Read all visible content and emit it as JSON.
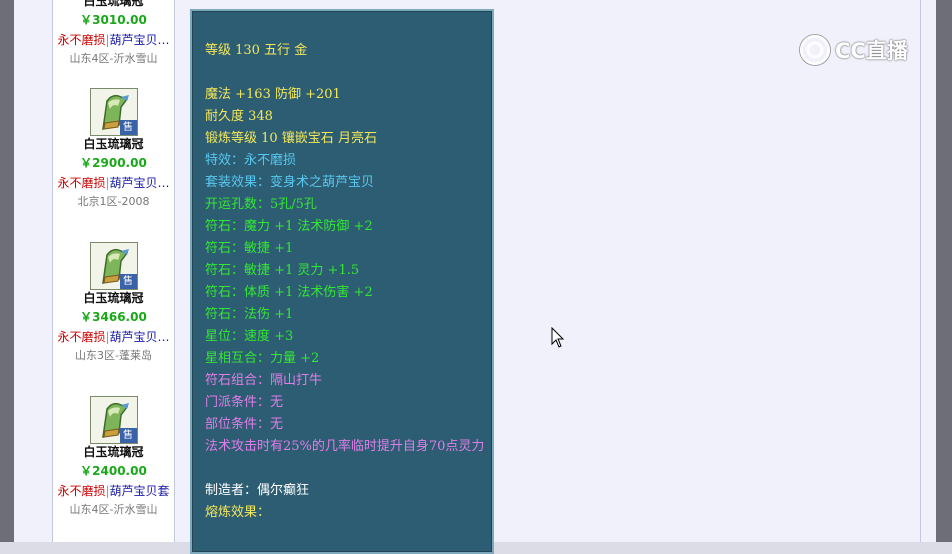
{
  "sidebar": {
    "top_item": {
      "name": "白玉琉璃冠",
      "price": "￥3010.00",
      "tag_red": "永不磨损",
      "tag_sep": "|",
      "tag_blue": "葫芦宝贝…",
      "server": "山东4区-沂水雪山"
    },
    "items": [
      {
        "badge": "售",
        "name": "白玉琉璃冠",
        "price": "￥2900.00",
        "tag_red": "永不磨损",
        "tag_sep": "|",
        "tag_blue": "葫芦宝贝…",
        "server": "北京1区-2008"
      },
      {
        "badge": "售",
        "name": "白玉琉璃冠",
        "price": "￥3466.00",
        "tag_red": "永不磨损",
        "tag_sep": "|",
        "tag_blue": "葫芦宝贝…",
        "server": "山东3区-蓬莱岛"
      },
      {
        "badge": "售",
        "name": "白玉琉璃冠",
        "price": "￥2400.00",
        "tag_red": "永不磨损",
        "tag_sep": "|",
        "tag_blue": "葫芦宝贝套",
        "server": "山东4区-沂水雪山"
      }
    ]
  },
  "tooltip": {
    "level_line": "等级 130 五行 金",
    "magic_defense": "魔法 +163 防御 +201",
    "durability": "耐久度 348",
    "forge": "锻炼等级 10 镶嵌宝石 月亮石",
    "special": "特效：永不磨损",
    "set_effect": "套装效果：变身术之葫芦宝贝",
    "holes": "开运孔数：5孔/5孔",
    "rune1": "符石：魔力 +1 法术防御 +2",
    "rune2": "符石：敏捷 +1",
    "rune3": "符石：敏捷 +1 灵力 +1.5",
    "rune4": "符石：体质 +1 法术伤害 +2",
    "rune5": "符石：法伤 +1",
    "star": "星位：速度 +3",
    "star_match": "星相互合：力量 +2",
    "rune_combo": "符石组合：隔山打牛",
    "sect_req": "门派条件：无",
    "part_req": "部位条件：无",
    "effect": "法术攻击时有25%的几率临时提升自身70点灵力",
    "maker": "制造者：偶尔癫狂",
    "smelt": "熔炼效果："
  },
  "watermark": {
    "text": "CC直播"
  },
  "colors": {
    "tooltip_bg": "#2d5d72",
    "yellow": "#f3e75a",
    "light_blue": "#58c8f0",
    "green": "#33e733",
    "pink": "#e07de8",
    "price_green": "#18a818",
    "tag_red": "#cc0000",
    "tag_blue": "#1a1aa8"
  }
}
